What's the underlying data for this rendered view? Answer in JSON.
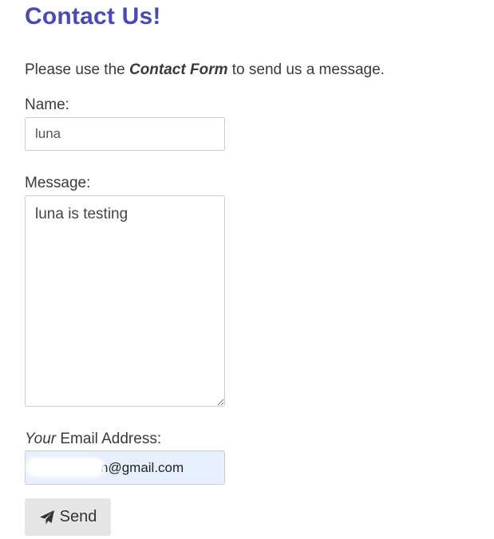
{
  "page": {
    "title": "Contact Us!"
  },
  "intro": {
    "prefix": "Please use the ",
    "emphasis": "Contact Form",
    "suffix": " to send us a message."
  },
  "form": {
    "name_label": "Name:",
    "name_value": "luna",
    "message_label": "Message:",
    "message_value": "luna is testing",
    "email_label_em": "Your",
    "email_label_rest": " Email Address:",
    "email_value": "n@gmail.com",
    "send_label": "Send",
    "send_icon": "paper-plane-icon"
  },
  "colors": {
    "title": "#4a4ab0",
    "email_autofill_bg": "#e8f0fe",
    "button_bg": "#e6e6e6"
  }
}
